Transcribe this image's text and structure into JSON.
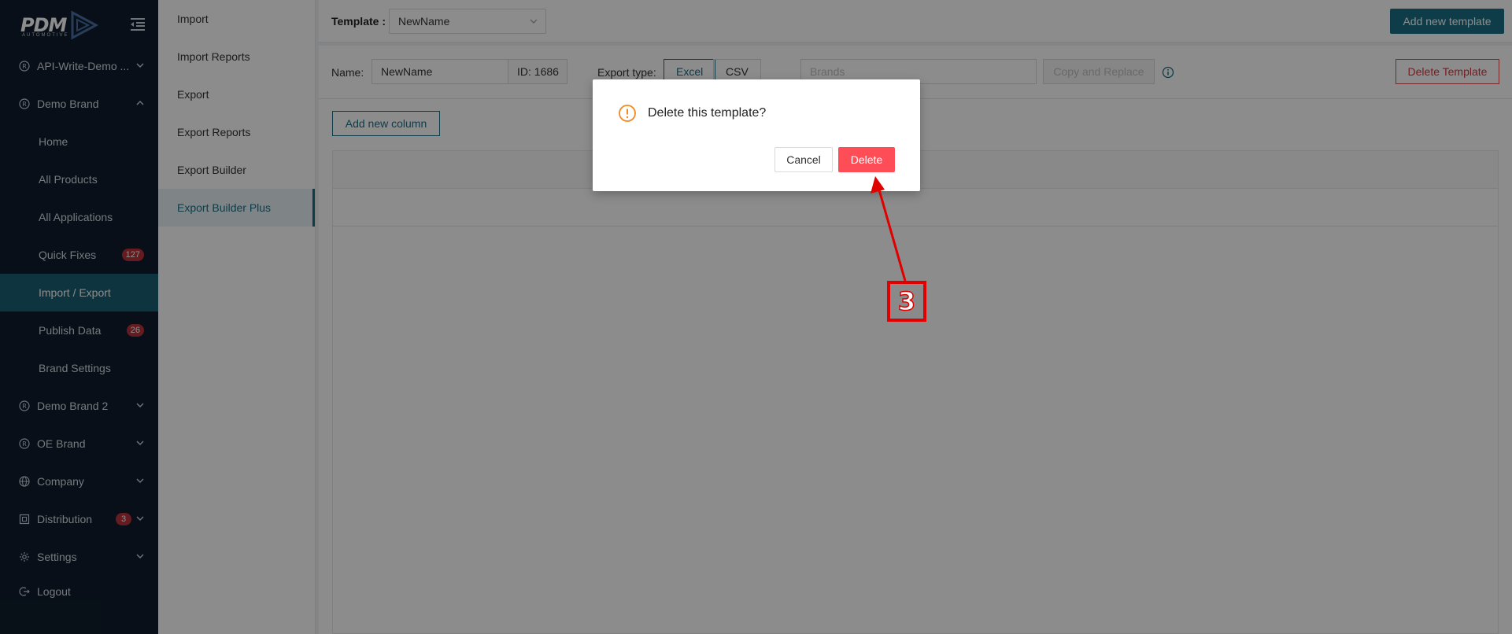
{
  "brand": {
    "logo_text": "PDM",
    "logo_sub": "AUTOMOTIVE"
  },
  "sidebar": {
    "items": [
      {
        "label": "API-Write-Demo ...",
        "icon": "registered-icon"
      },
      {
        "label": "Demo Brand",
        "icon": "registered-icon"
      },
      {
        "label": "Demo Brand 2",
        "icon": "registered-icon"
      },
      {
        "label": "OE Brand",
        "icon": "registered-icon"
      },
      {
        "label": "Company",
        "icon": "globe-icon"
      },
      {
        "label": "Distribution",
        "icon": "box-icon",
        "badge": "3"
      },
      {
        "label": "Settings",
        "icon": "gear-icon"
      },
      {
        "label": "Logout",
        "icon": "logout-icon"
      }
    ],
    "subitems": [
      {
        "label": "Home"
      },
      {
        "label": "All Products"
      },
      {
        "label": "All Applications"
      },
      {
        "label": "Quick Fixes",
        "badge": "127"
      },
      {
        "label": "Import / Export"
      },
      {
        "label": "Publish Data",
        "badge": "26"
      },
      {
        "label": "Brand Settings"
      }
    ]
  },
  "subpanel": {
    "items": [
      "Import",
      "Import Reports",
      "Export",
      "Export Reports",
      "Export Builder",
      "Export Builder Plus"
    ]
  },
  "topbar": {
    "template_label": "Template :",
    "template_value": "NewName",
    "add_button": "Add new template"
  },
  "form": {
    "name_label": "Name:",
    "name_value": "NewName",
    "id_text": "ID: 1686",
    "export_type_label": "Export type:",
    "type_excel": "Excel",
    "type_csv": "CSV",
    "brands_placeholder": "Brands",
    "copy_replace": "Copy and Replace",
    "delete_template": "Delete Template"
  },
  "content": {
    "add_column": "Add new column"
  },
  "modal": {
    "title": "Delete this template?",
    "cancel": "Cancel",
    "delete": "Delete"
  },
  "annotation": {
    "step": "3"
  },
  "colors": {
    "accent": "#1a6f85",
    "danger": "#ff4d57",
    "sidebar_bg": "#0f1d2c"
  }
}
